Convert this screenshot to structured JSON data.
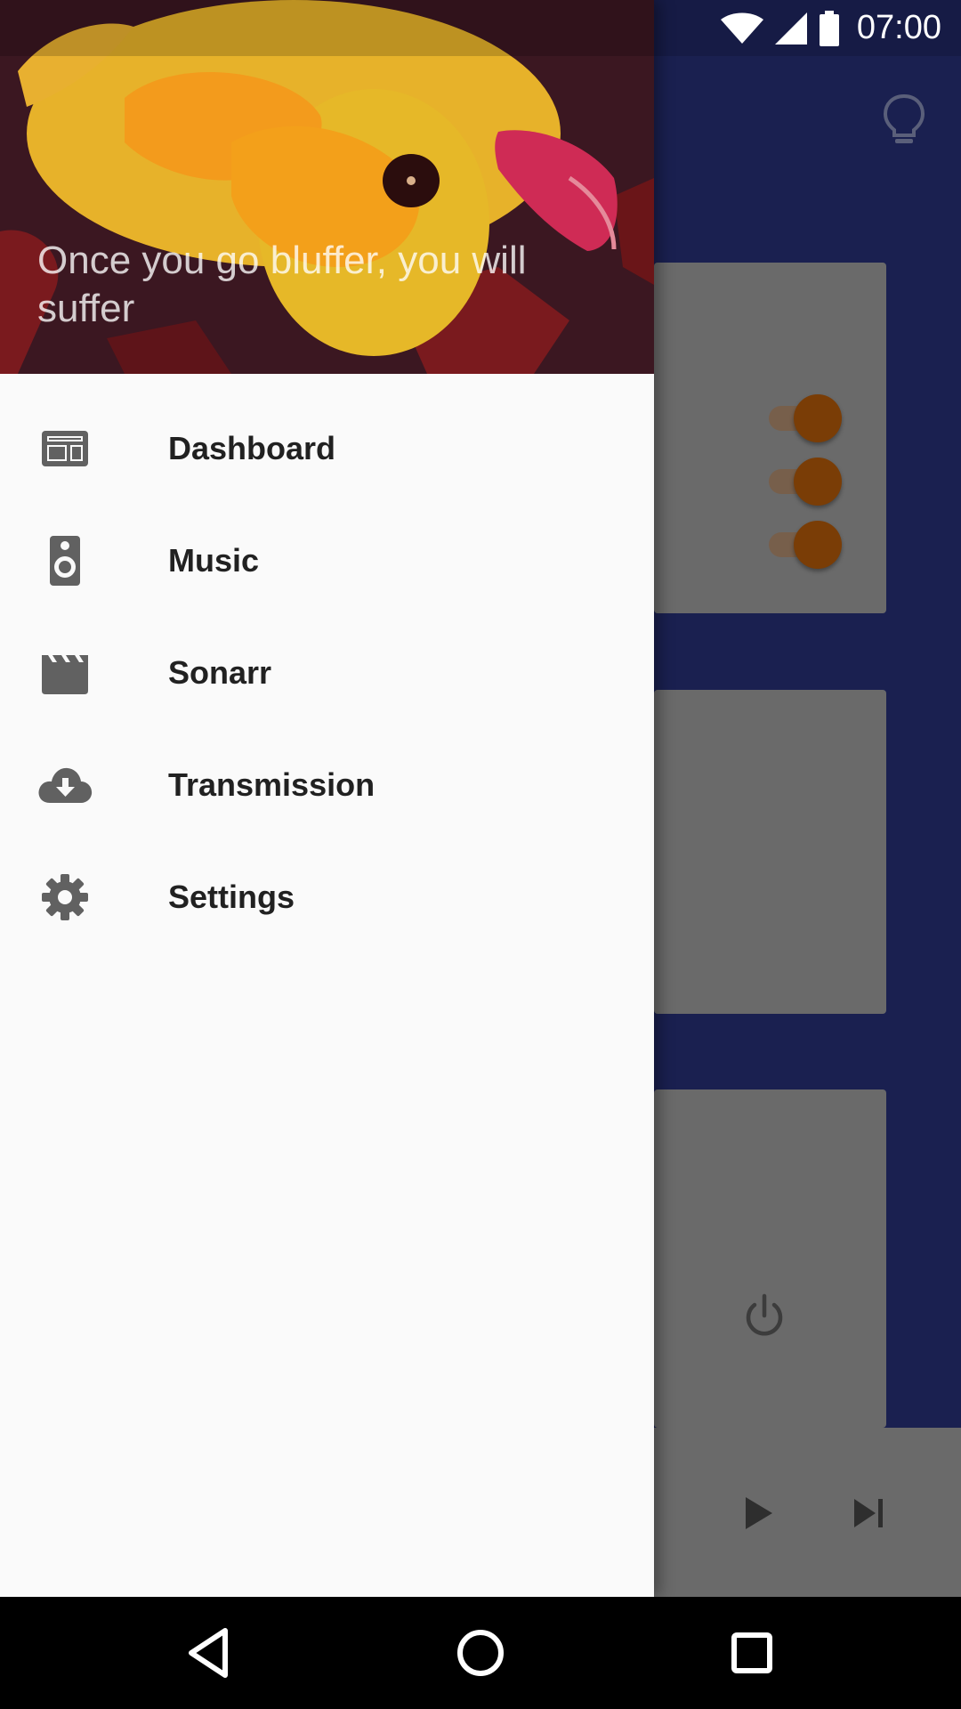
{
  "status_bar": {
    "time": "07:00",
    "icons": [
      "wifi-icon",
      "cell-signal-icon",
      "battery-icon"
    ]
  },
  "background_app": {
    "toolbar_icon": "lightbulb-icon",
    "toggles_on": [
      true,
      true,
      true
    ],
    "power_icon": "power-icon",
    "player_controls": [
      "play-icon",
      "skip-next-icon"
    ],
    "colors": {
      "primary": "#1a2050",
      "accent": "#7a3d06"
    }
  },
  "drawer": {
    "header": {
      "tagline": "Once you go bluffer, you will suffer",
      "image": "rubber-duck-artwork"
    },
    "items": [
      {
        "label": "Dashboard",
        "icon": "dashboard-icon"
      },
      {
        "label": "Music",
        "icon": "speaker-icon"
      },
      {
        "label": "Sonarr",
        "icon": "clapperboard-icon"
      },
      {
        "label": "Transmission",
        "icon": "cloud-download-icon"
      },
      {
        "label": "Settings",
        "icon": "gear-icon"
      }
    ]
  },
  "nav_bar": {
    "buttons": [
      "back-icon",
      "home-icon",
      "recents-icon"
    ]
  }
}
